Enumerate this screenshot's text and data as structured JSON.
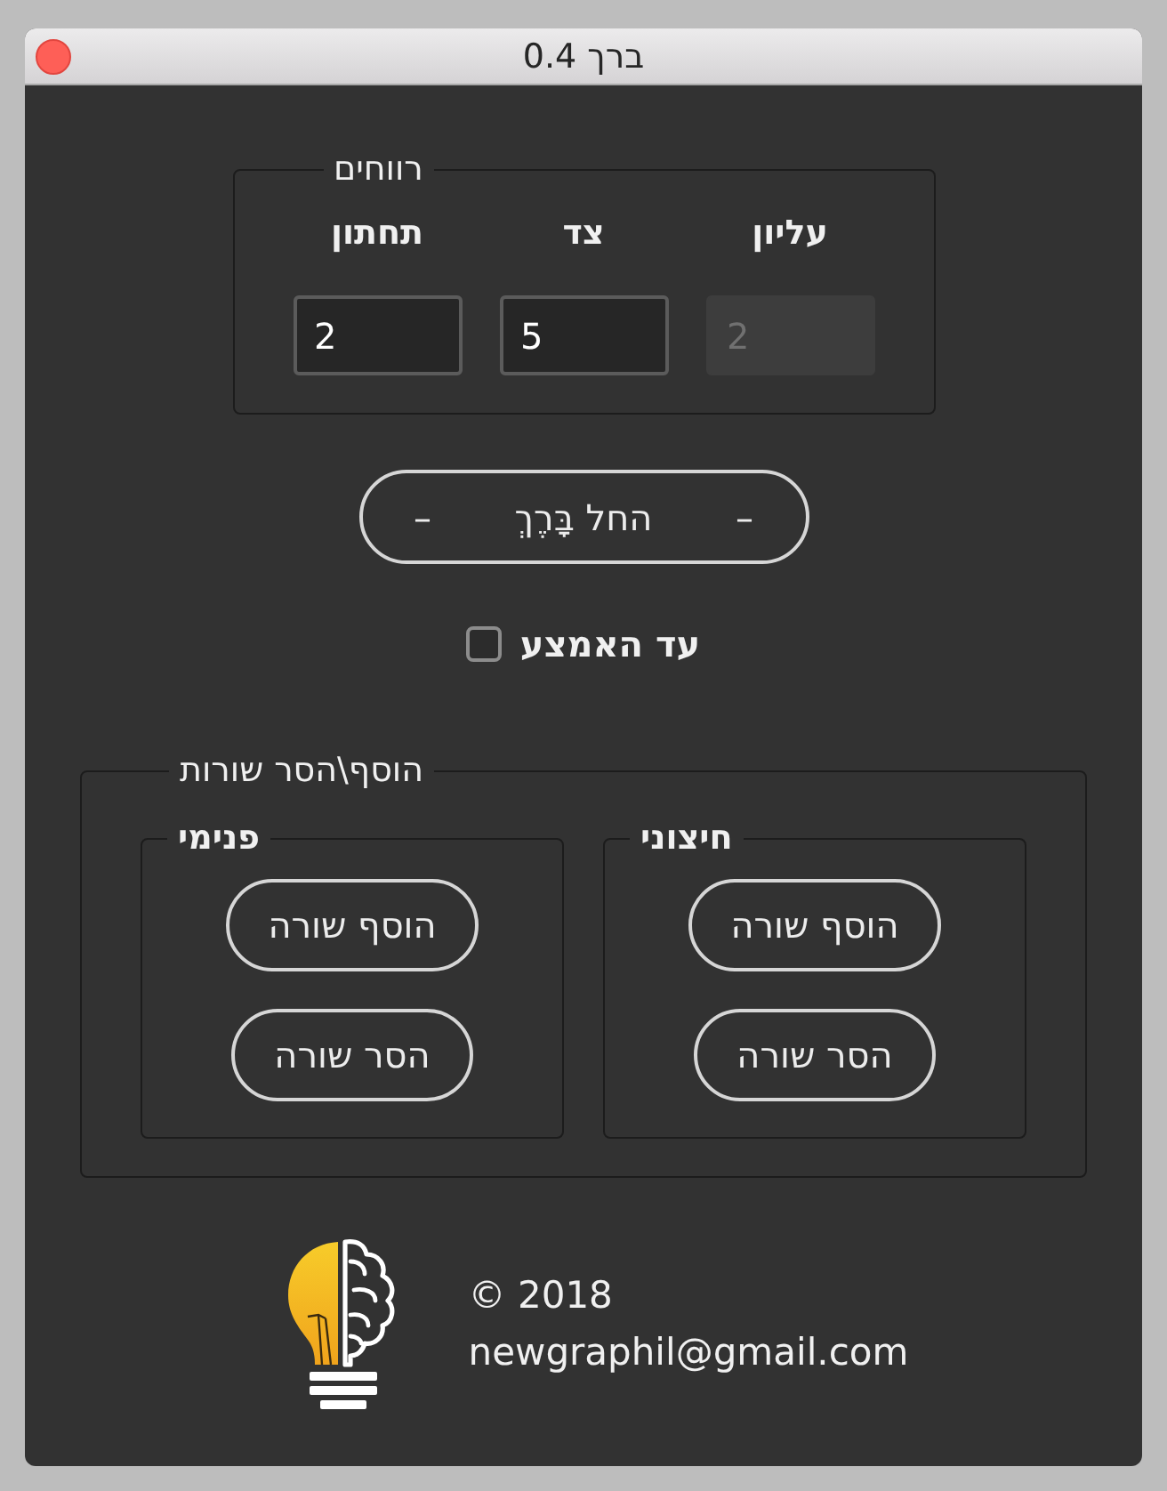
{
  "window": {
    "title": "ברך 0.4"
  },
  "margins": {
    "legend": "רווחים",
    "fields": [
      {
        "label": "עליון",
        "value": "2",
        "disabled": true
      },
      {
        "label": "צד",
        "value": "5",
        "disabled": false
      },
      {
        "label": "תחתון",
        "value": "2",
        "disabled": false
      }
    ]
  },
  "start_button": {
    "label": "החל בָּרֶךְ",
    "marks": [
      "–",
      "–"
    ]
  },
  "options": [
    {
      "label": "עד האמצע",
      "checked": false
    }
  ],
  "rows_group": {
    "legend": "הוסף\\הסר שורות",
    "groups": [
      {
        "legend": "חיצוני",
        "buttons": [
          "הוסף שורה",
          "הסר שורה"
        ]
      },
      {
        "legend": "פנימי",
        "buttons": [
          "הוסף שורה",
          "הסר שורה"
        ]
      }
    ]
  },
  "footer": {
    "copyright": "© 2018",
    "email": "newgraphil@gmail.com"
  }
}
